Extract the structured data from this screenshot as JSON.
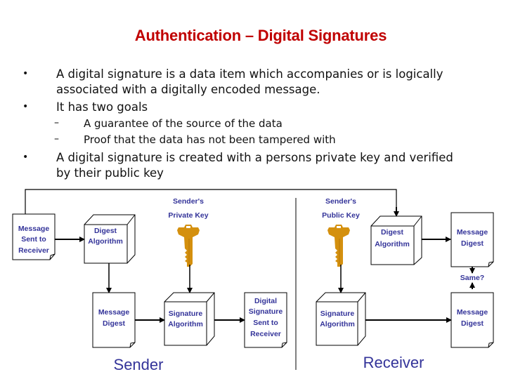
{
  "slide": {
    "title": "Authentication – Digital Signatures",
    "bullets": [
      {
        "marker": "•",
        "text_lines": [
          "A digital signature is a data item which accompanies or is logically",
          "associated with a digitally encoded message."
        ]
      },
      {
        "marker": "•",
        "text_lines": [
          "It has two goals"
        ],
        "sub_bullets": [
          {
            "marker": "–",
            "text": "A guarantee of the source of the data"
          },
          {
            "marker": "–",
            "text": "Proof that the data has not been tampered with"
          }
        ]
      },
      {
        "marker": "•",
        "text_lines": [
          "A digital signature is created with a persons private key and verified",
          "by their public key"
        ]
      }
    ]
  },
  "diagram": {
    "colors": {
      "label": "#333399",
      "key": "#d4900e",
      "line": "#000000",
      "title": "#c00000"
    },
    "sender_section_label": "Sender",
    "receiver_section_label": "Receiver",
    "private_key": {
      "line1": "Sender's",
      "line2": "Private Key",
      "icon": "key-icon"
    },
    "public_key": {
      "line1": "Sender's",
      "line2": "Public Key",
      "icon": "key-icon"
    },
    "nodes": {
      "message_sent": [
        "Message",
        "Sent to",
        "Receiver"
      ],
      "sender_digest_algo": [
        "Digest",
        "Algorithm"
      ],
      "sender_message_digest": [
        "Message",
        "Digest"
      ],
      "sender_signature_algo": [
        "Signature",
        "Algorithm"
      ],
      "digital_signature_sent": [
        "Digital",
        "Signature",
        "Sent to",
        "Receiver"
      ],
      "receiver_signature_algo": [
        "Signature",
        "Algorithm"
      ],
      "receiver_message_digest": [
        "Message",
        "Digest"
      ],
      "receiver_digest_algo": [
        "Digest",
        "Algorithm"
      ],
      "computed_message_digest": [
        "Message",
        "Digest"
      ]
    },
    "compare_label": "Same?"
  }
}
